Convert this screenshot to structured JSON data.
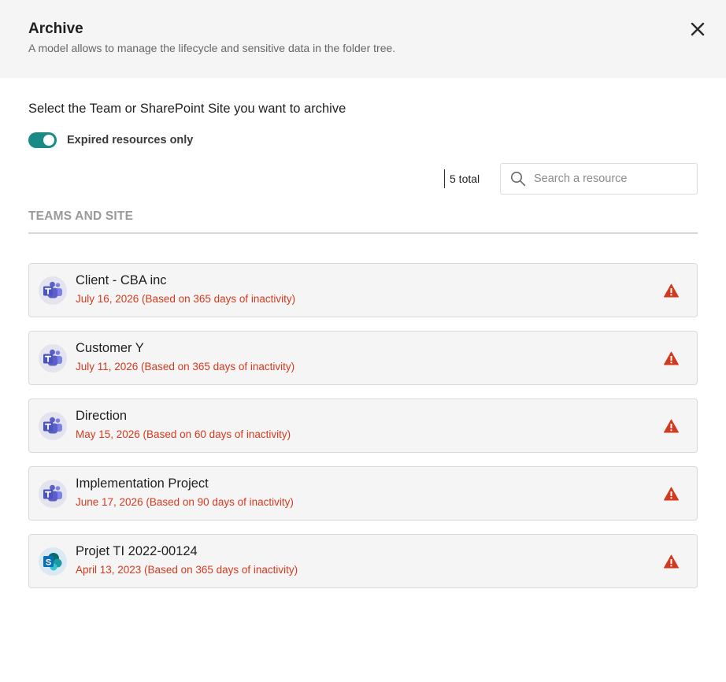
{
  "header": {
    "title": "Archive",
    "subtitle": "A model allows to manage the lifecycle and sensitive data in the folder tree.",
    "close_icon": "close-icon"
  },
  "prompt": "Select the Team or SharePoint Site you want to archive",
  "filter": {
    "toggle_label": "Expired resources only",
    "toggle_on": true,
    "toggle_color": "#1a8a87"
  },
  "total": "5 total",
  "search": {
    "placeholder": "Search a resource",
    "value": ""
  },
  "section_title": "TEAMS AND SITE",
  "colors": {
    "warning": "#d23a1f",
    "teams": "#5b5fc7",
    "sharepoint": "#0b6fb8"
  },
  "items": [
    {
      "name": "Client - CBA inc",
      "date": "July 16, 2026 (Based on 365 days of inactivity)",
      "type": "teams",
      "icon": "teams-icon"
    },
    {
      "name": "Customer Y",
      "date": "July 11, 2026 (Based on 365 days of inactivity)",
      "type": "teams",
      "icon": "teams-icon"
    },
    {
      "name": "Direction",
      "date": "May 15, 2026 (Based on 60 days of inactivity)",
      "type": "teams",
      "icon": "teams-icon"
    },
    {
      "name": "Implementation Project",
      "date": "June 17, 2026 (Based on 90 days of inactivity)",
      "type": "teams",
      "icon": "teams-icon"
    },
    {
      "name": "Projet TI 2022-00124",
      "date": "April 13, 2023 (Based on 365 days of inactivity)",
      "type": "sharepoint",
      "icon": "sharepoint-icon"
    }
  ]
}
